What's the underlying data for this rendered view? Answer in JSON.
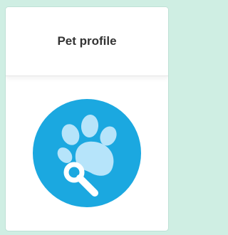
{
  "card": {
    "title": "Pet profile",
    "icon": "pet-paw-search-icon"
  },
  "colors": {
    "background": "#cfeee3",
    "icon_circle": "#1ba8e0",
    "paw": "#b6e4fa",
    "magnifier": "#ffffff"
  }
}
